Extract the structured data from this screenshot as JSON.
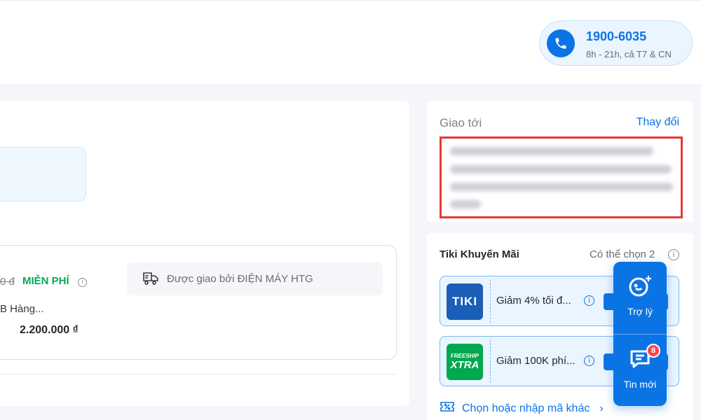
{
  "header": {
    "hotline": {
      "number": "1900-6035",
      "hours": "8h - 21h, cả T7 & CN"
    }
  },
  "order": {
    "old_price": "0 đ",
    "shipping_free": "MIỄN PHÍ",
    "shipped_by": "Được giao bởi ĐIỆN MÁY HTG",
    "product_name": "B Hàng...",
    "product_price": "2.200.000 ₫"
  },
  "delivery": {
    "title": "Giao tới",
    "change": "Thay đổi"
  },
  "promotions": {
    "title": "Tiki Khuyến Mãi",
    "choose_note": "Có thể chọn 2",
    "coupons": [
      {
        "logo_lines": [
          "TIKI"
        ],
        "logo_color": "#1a5eb8",
        "text": "Giảm 4% tối đ..."
      },
      {
        "logo_lines": [
          "FREESHIP",
          "XTRA"
        ],
        "logo_color": "#00a84f",
        "text": "Giảm 100K phí..."
      }
    ],
    "other_code": "Chọn hoặc nhập mã khác"
  },
  "floating": {
    "assistant": "Trợ lý",
    "messages": "Tin mới",
    "message_count": "8"
  },
  "colors": {
    "brand_blue": "#0b74e5",
    "free_green": "#00ab56",
    "highlight_red": "#e53935",
    "badge_red": "#ff424e"
  }
}
